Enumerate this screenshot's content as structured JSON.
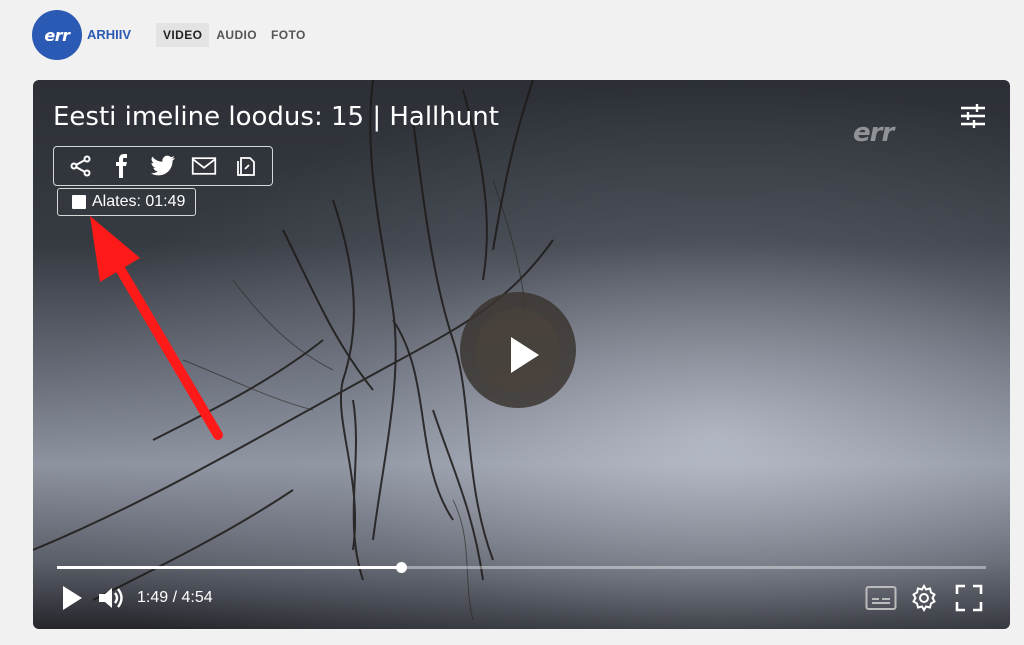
{
  "header": {
    "logo_text": "err",
    "brand": "ARHIIV",
    "nav": [
      {
        "label": "VIDEO",
        "active": true
      },
      {
        "label": "AUDIO",
        "active": false
      },
      {
        "label": "FOTO",
        "active": false
      }
    ]
  },
  "player": {
    "title": "Eesti imeline loodus: 15 | Hallhunt",
    "watermark": "err",
    "share_icons": [
      "share-icon",
      "facebook-icon",
      "twitter-icon",
      "mail-icon",
      "copy-link-icon"
    ],
    "alates_label": "Alates: 01:49",
    "alates_checked": false,
    "current_time": "1:49",
    "duration": "4:54",
    "time_display": "1:49 / 4:54",
    "progress_fraction": 0.37,
    "controls": {
      "play": "play-icon",
      "volume": "volume-icon",
      "subtitles": "subtitles-icon",
      "settings": "gear-icon",
      "fullscreen": "fullscreen-icon"
    }
  },
  "colors": {
    "brand_blue": "#2a5ab3",
    "annotation_arrow": "#ff1a1a"
  }
}
